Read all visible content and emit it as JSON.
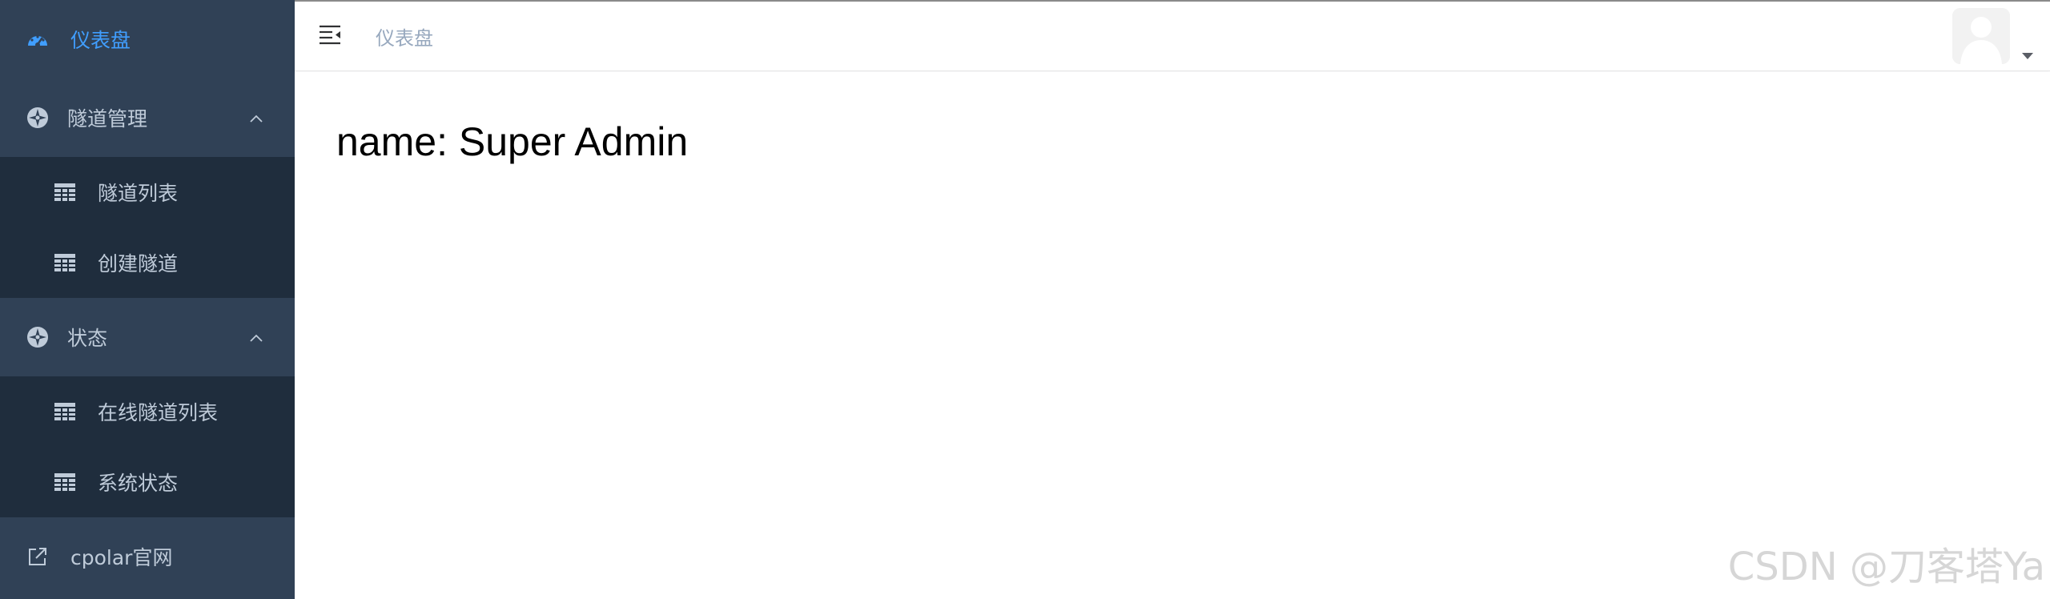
{
  "sidebar": {
    "dashboard": {
      "label": "仪表盘",
      "icon": "dashboard-icon"
    },
    "tunnel_management": {
      "label": "隧道管理",
      "icon": "compass-icon",
      "items": [
        {
          "label": "隧道列表",
          "icon": "table-icon"
        },
        {
          "label": "创建隧道",
          "icon": "table-icon"
        }
      ]
    },
    "status": {
      "label": "状态",
      "icon": "compass-icon",
      "items": [
        {
          "label": "在线隧道列表",
          "icon": "table-icon"
        },
        {
          "label": "系统状态",
          "icon": "table-icon"
        }
      ]
    },
    "official_site": {
      "label": "cpolar官网",
      "icon": "external-link-icon"
    }
  },
  "navbar": {
    "breadcrumb": "仪表盘"
  },
  "main": {
    "dashboard_text": "name: Super Admin"
  },
  "watermark": "CSDN @刀客塔Ya",
  "colors": {
    "sidebar_bg": "#304156",
    "submenu_bg": "#1f2d3d",
    "menu_text": "#bfcbd9",
    "active": "#409eff"
  }
}
